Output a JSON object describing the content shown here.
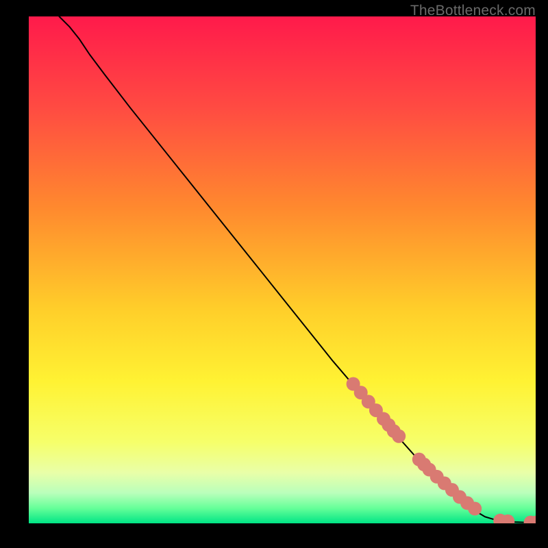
{
  "watermark": "TheBottleneck.com",
  "chart_data": {
    "type": "line",
    "title": "",
    "xlabel": "",
    "ylabel": "",
    "xlim": [
      0,
      100
    ],
    "ylim": [
      0,
      100
    ],
    "grid": false,
    "legend": false,
    "gradient_stops": [
      {
        "pct": 0,
        "color": "#ff1a4b"
      },
      {
        "pct": 18,
        "color": "#ff4b42"
      },
      {
        "pct": 38,
        "color": "#ff8a2e"
      },
      {
        "pct": 58,
        "color": "#ffcf2a"
      },
      {
        "pct": 72,
        "color": "#fff233"
      },
      {
        "pct": 84,
        "color": "#f6ff6a"
      },
      {
        "pct": 90,
        "color": "#e9ffa8"
      },
      {
        "pct": 94,
        "color": "#baffbb"
      },
      {
        "pct": 97,
        "color": "#66ff99"
      },
      {
        "pct": 100,
        "color": "#00e585"
      }
    ],
    "series": [
      {
        "name": "curve",
        "type": "line",
        "x": [
          6,
          8,
          10,
          12,
          15,
          20,
          30,
          40,
          50,
          60,
          66,
          72,
          76,
          80,
          83,
          86,
          88,
          90,
          92,
          94,
          96,
          98,
          100
        ],
        "y": [
          100,
          98,
          95.5,
          92.5,
          88.5,
          82,
          69.5,
          57,
          44.5,
          32,
          25,
          18,
          13.5,
          9.5,
          6.5,
          4,
          2.5,
          1.3,
          0.7,
          0.4,
          0.25,
          0.18,
          0.15
        ]
      },
      {
        "name": "markers",
        "type": "scatter",
        "color": "#d97a72",
        "radius": 10,
        "x": [
          64,
          65.5,
          67,
          68.5,
          70,
          71,
          72,
          73,
          77,
          78,
          79,
          80.5,
          82,
          83.5,
          85,
          86.5,
          88,
          93,
          94.5,
          99,
          100
        ],
        "y": [
          27.5,
          25.8,
          24,
          22.3,
          20.6,
          19.4,
          18.2,
          17.2,
          12.6,
          11.6,
          10.6,
          9.2,
          7.9,
          6.6,
          5.2,
          4,
          2.9,
          0.55,
          0.4,
          0.17,
          0.15
        ]
      }
    ]
  }
}
